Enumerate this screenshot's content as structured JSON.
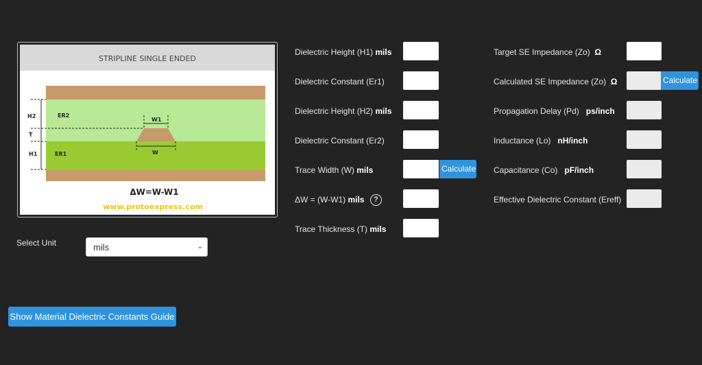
{
  "diagram": {
    "title": "STRIPLINE SINGLE ENDED",
    "labels": {
      "h2": "H2",
      "t": "T",
      "h1": "H1",
      "er2": "ER2",
      "er1": "ER1",
      "w1": "W1",
      "w": "W"
    },
    "formula": "ΔW=W-W1",
    "website": "www.protoexpress.com",
    "colors": {
      "copper": "#c8996a",
      "er2": "#b8e994",
      "er1": "#99cc33",
      "header": "#d9d9d9",
      "website": "#f2c700"
    }
  },
  "inputs_left": [
    {
      "label": "Dielectric Height (H1)",
      "unit": "mils",
      "value": ""
    },
    {
      "label": "Dielectric Constant (Er1)",
      "unit": "",
      "value": ""
    },
    {
      "label": "Dielectric Height (H2)",
      "unit": "mils",
      "value": ""
    },
    {
      "label": "Dielectric Constant (Er2)",
      "unit": "",
      "value": ""
    },
    {
      "label": "Trace Width (W)",
      "unit": "mils",
      "value": "",
      "button": "Calculate"
    },
    {
      "label": "ΔW = (W-W1)",
      "unit": "mils",
      "value": "",
      "help": "?"
    },
    {
      "label": "Trace Thickness (T)",
      "unit": "mils",
      "value": ""
    }
  ],
  "outputs_right": [
    {
      "label": "Target SE Impedance (Zo)",
      "unit": "Ω",
      "value": ""
    },
    {
      "label": "Calculated SE Impedance (Zo)",
      "unit": "Ω",
      "value": "",
      "button": "Calculate"
    },
    {
      "label": "Propagation Delay (Pd)",
      "unit": "ps/inch",
      "value": ""
    },
    {
      "label": "Inductance (Lo)",
      "unit": "nH/inch",
      "value": ""
    },
    {
      "label": "Capacitance (Co)",
      "unit": "pF/inch",
      "value": ""
    },
    {
      "label": "Effective Dielectric Constant (Ereff)",
      "unit": "",
      "value": ""
    }
  ],
  "unit_select": {
    "label": "Select Unit",
    "value": "mils"
  },
  "guide_button": "Show Material Dielectric Constants Guide",
  "accent": "#2f93dd"
}
